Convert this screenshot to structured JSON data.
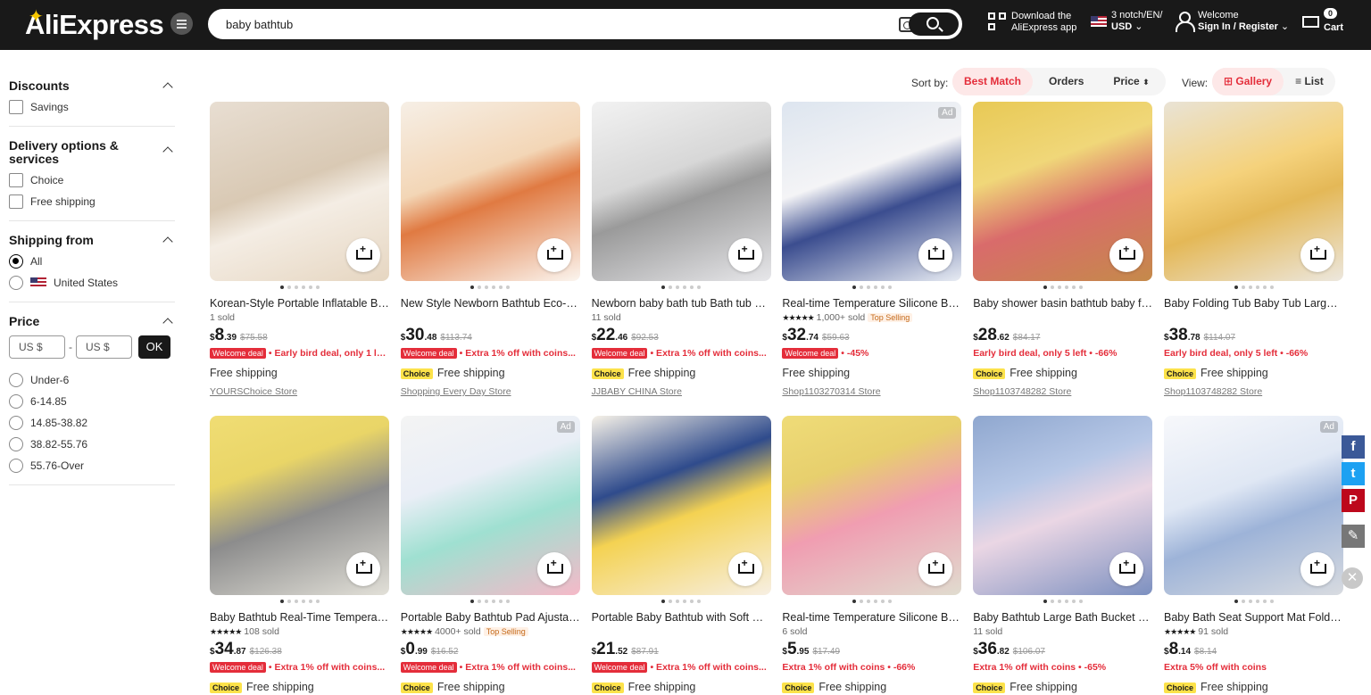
{
  "header": {
    "logo": "AliExpress",
    "search_value": "baby bathtub",
    "download_line1": "Download the",
    "download_line2": "AliExpress app",
    "region_line1": "3 notch/EN/",
    "region_line2": "USD",
    "welcome_line1": "Welcome",
    "welcome_line2": "Sign In / Register",
    "cart_count": "0",
    "cart_label": "Cart"
  },
  "sidebar": {
    "discounts_title": "Discounts",
    "savings": "Savings",
    "delivery_title": "Delivery options & services",
    "choice": "Choice",
    "free_shipping": "Free shipping",
    "shipping_from_title": "Shipping from",
    "all": "All",
    "united_states": "United States",
    "price_title": "Price",
    "min_placeholder": "US $",
    "dash": "-",
    "max_placeholder": "US $",
    "ok": "OK",
    "ranges": [
      "Under-6",
      "6-14.85",
      "14.85-38.82",
      "38.82-55.76",
      "55.76-Over"
    ]
  },
  "sort": {
    "label": "Sort by:",
    "best_match": "Best Match",
    "orders": "Orders",
    "price": "Price",
    "view_label": "View:",
    "gallery": "Gallery",
    "list": "List"
  },
  "products": [
    {
      "title": "Korean-Style Portable Inflatable Ba...",
      "meta": "1 sold",
      "stars": false,
      "top": false,
      "price_int": "8",
      "price_dec": ".39",
      "orig": "$75.58",
      "welcome": true,
      "promo": "• Early bird deal, only 1 le...",
      "choice": false,
      "ship": "Free shipping",
      "store": "YOURSChoice Store",
      "ad": false
    },
    {
      "title": "New Style Newborn Bathtub Eco-Fri...",
      "meta": "",
      "stars": false,
      "top": false,
      "price_int": "30",
      "price_dec": ".48",
      "orig": "$113.74",
      "welcome": true,
      "promo": "• Extra 1% off with coins...",
      "choice": true,
      "ship": "Free shipping",
      "store": "Shopping Every Day Store",
      "ad": false
    },
    {
      "title": "Newborn baby bath tub Bath tub H...",
      "meta": "11 sold",
      "stars": false,
      "top": false,
      "price_int": "22",
      "price_dec": ".46",
      "orig": "$92.53",
      "welcome": true,
      "promo": "• Extra 1% off with coins...",
      "choice": true,
      "ship": "Free shipping",
      "store": "JJBABY CHINA Store",
      "ad": false
    },
    {
      "title": "Real-time Temperature Silicone Ba...",
      "meta": "1,000+ sold",
      "stars": true,
      "top": true,
      "price_int": "32",
      "price_dec": ".74",
      "orig": "$59.63",
      "welcome": true,
      "promo": "• -45%",
      "choice": false,
      "ship": "Free shipping",
      "store": "Shop1103270314 Store",
      "ad": true
    },
    {
      "title": "Baby shower basin bathtub baby fo...",
      "meta": "",
      "stars": false,
      "top": false,
      "price_int": "28",
      "price_dec": ".62",
      "orig": "$84.17",
      "welcome": false,
      "promo": "Early bird deal, only 5 left • -66%",
      "choice": true,
      "ship": "Free shipping",
      "store": "Shop1103748282 Store",
      "ad": false
    },
    {
      "title": "Baby Folding Tub Baby Tub Large Si...",
      "meta": "",
      "stars": false,
      "top": false,
      "price_int": "38",
      "price_dec": ".78",
      "orig": "$114.07",
      "welcome": false,
      "promo": "Early bird deal, only 5 left • -66%",
      "choice": true,
      "ship": "Free shipping",
      "store": "Shop1103748282 Store",
      "ad": false
    },
    {
      "title": "Baby Bathtub Real-Time Temperatu...",
      "meta": "108 sold",
      "stars": true,
      "top": false,
      "price_int": "34",
      "price_dec": ".87",
      "orig": "$126.38",
      "welcome": true,
      "promo": "• Extra 1% off with coins...",
      "choice": true,
      "ship": "Free shipping",
      "store": "",
      "ad": false
    },
    {
      "title": "Portable Baby Bathtub Pad Ajustabl...",
      "meta": "4000+ sold",
      "stars": true,
      "top": true,
      "price_int": "0",
      "price_dec": ".99",
      "orig": "$16.52",
      "welcome": true,
      "promo": "• Extra 1% off with coins...",
      "choice": true,
      "ship": "Free shipping",
      "store": "",
      "ad": true
    },
    {
      "title": "Portable Baby Bathtub with Soft Cu...",
      "meta": "",
      "stars": false,
      "top": false,
      "price_int": "21",
      "price_dec": ".52",
      "orig": "$87.91",
      "welcome": true,
      "promo": "• Extra 1% off with coins...",
      "choice": true,
      "ship": "Free shipping",
      "store": "",
      "ad": false
    },
    {
      "title": "Real-time Temperature Silicone Ba...",
      "meta": "6 sold",
      "stars": false,
      "top": false,
      "price_int": "5",
      "price_dec": ".95",
      "orig": "$17.49",
      "welcome": false,
      "promo": "Extra 1% off with coins • -66%",
      "choice": true,
      "ship": "Free shipping",
      "store": "",
      "ad": false
    },
    {
      "title": "Baby Bathtub Large Bath Bucket Ba...",
      "meta": "11 sold",
      "stars": false,
      "top": false,
      "price_int": "36",
      "price_dec": ".82",
      "orig": "$106.07",
      "welcome": false,
      "promo": "Extra 1% off with coins • -65%",
      "choice": true,
      "ship": "Free shipping",
      "store": "",
      "ad": false
    },
    {
      "title": "Baby Bath Seat Support Mat Foldab...",
      "meta": "91 sold",
      "stars": true,
      "top": false,
      "price_int": "8",
      "price_dec": ".14",
      "orig": "$8.14",
      "welcome": false,
      "promo": "Extra 5% off with coins",
      "choice": true,
      "ship": "Free shipping",
      "store": "",
      "ad": true
    }
  ],
  "labels": {
    "welcome_deal": "Welcome deal",
    "choice": "Choice",
    "top_selling": "Top Selling",
    "ad": "Ad",
    "currency": "$",
    "stars": "★★★★★"
  },
  "social": {
    "facebook": "f",
    "twitter": "t",
    "pinterest": "P",
    "edit": "✎",
    "close": "✕"
  }
}
